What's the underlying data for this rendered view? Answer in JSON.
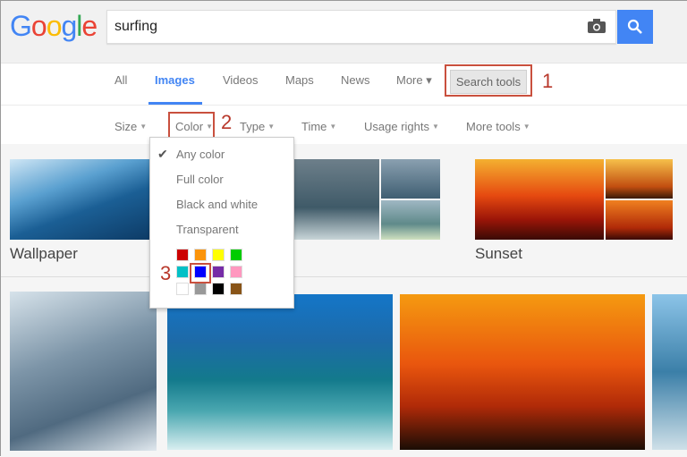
{
  "logo": "Google",
  "search": {
    "value": "surfing"
  },
  "nav": {
    "tabs": [
      {
        "label": "All"
      },
      {
        "label": "Images",
        "active": true
      },
      {
        "label": "Videos"
      },
      {
        "label": "Maps"
      },
      {
        "label": "News"
      },
      {
        "label": "More ▾"
      }
    ],
    "search_tools": "Search tools"
  },
  "tools": [
    {
      "label": "Size"
    },
    {
      "label": "Color"
    },
    {
      "label": "Type"
    },
    {
      "label": "Time"
    },
    {
      "label": "Usage rights"
    },
    {
      "label": "More tools"
    }
  ],
  "color_menu": {
    "items": [
      "Any color",
      "Full color",
      "Black and white",
      "Transparent"
    ],
    "selected": "Any color",
    "swatches": [
      "#cc0000",
      "#fb940b",
      "#ffff00",
      "#00cc00",
      "#03c0c6",
      "#0000ff",
      "#762ca7",
      "#ff98bf",
      "#ffffff",
      "#999999",
      "#000000",
      "#885418"
    ],
    "selected_swatch": "#0000ff"
  },
  "annotations": [
    "1",
    "2",
    "3"
  ],
  "results": {
    "row1_labels": [
      "Wallpaper",
      "Sunset"
    ]
  },
  "accent": "#4285f4",
  "annotation_color": "#b8372a"
}
